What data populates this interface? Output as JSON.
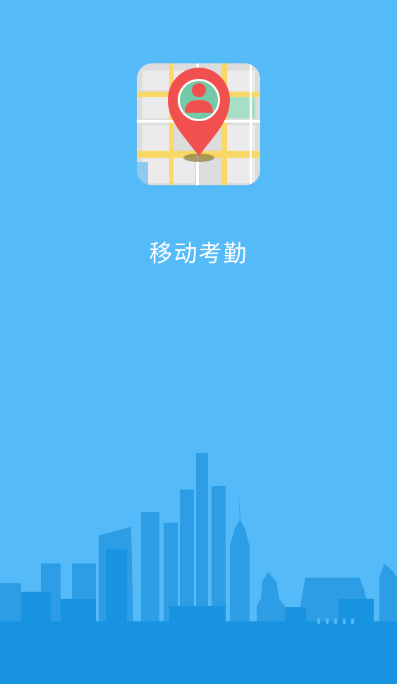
{
  "app": {
    "name": "移动考勤",
    "icon": "map-location-pin-icon"
  },
  "colors": {
    "background": "#55baf8",
    "skyline_back": "#2d9de6",
    "skyline_front": "#1893e0",
    "pin": "#f24f4f",
    "road": "#f9d866",
    "map_block": "#e6e6e6"
  }
}
